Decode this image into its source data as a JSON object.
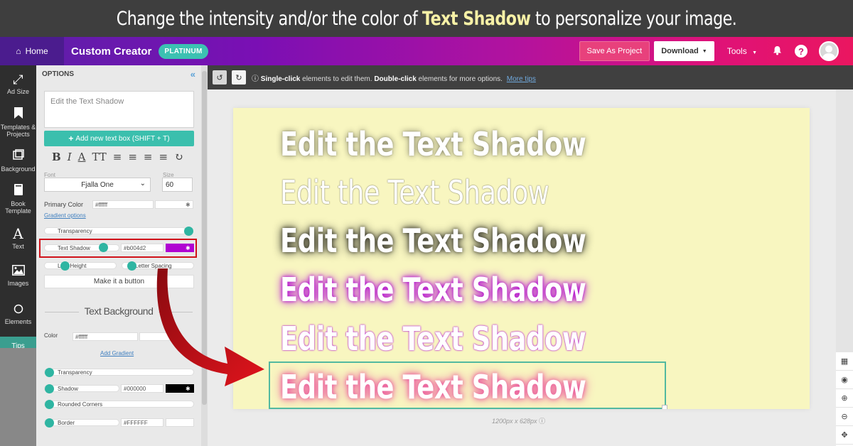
{
  "banner": {
    "prefix": "Change the intensity and/or the color of",
    "highlight": "Text Shadow",
    "suffix": "to personalize your image."
  },
  "nav": {
    "home": "Home",
    "brand": "Custom Creator",
    "badge": "PLATINUM",
    "save": "Save As Project",
    "download": "Download",
    "tools": "Tools",
    "help": "?"
  },
  "sidebar": {
    "items": [
      {
        "label": "Ad Size",
        "icon": "resize-icon"
      },
      {
        "label": "Templates & Projects",
        "icon": "bookmark-icon"
      },
      {
        "label": "Background",
        "icon": "background-icon"
      },
      {
        "label": "Book Template",
        "icon": "book-icon"
      },
      {
        "label": "Text",
        "icon": "text-icon"
      },
      {
        "label": "Images",
        "icon": "image-icon"
      },
      {
        "label": "Elements",
        "icon": "circle-icon"
      }
    ],
    "tips": "Tips"
  },
  "options": {
    "header": "OPTIONS",
    "textbox": "Edit the Text Shadow",
    "add_text": "Add new text box (SHIFT + T)",
    "font_label": "Font",
    "font_value": "Fjalla One",
    "size_label": "Size",
    "size_value": "60",
    "primary_color_label": "Primary Color",
    "primary_color_value": "#ffffff",
    "gradient_options": "Gradient options",
    "transparency": "Transparency",
    "text_shadow": "Text Shadow",
    "text_shadow_value": "#b004d2",
    "line_height": "Line Height",
    "letter_spacing": "Letter Spacing",
    "make_button": "Make it a button",
    "text_background": "Text Background",
    "color_label": "Color",
    "bg_color_value": "#ffffff",
    "add_gradient": "Add Gradient",
    "bg_transparency": "Transparency",
    "shadow": "Shadow",
    "shadow_value": "#000000",
    "rounded_corners": "Rounded Corners",
    "border": "Border",
    "border_value": "#FFFFFF"
  },
  "editor": {
    "hint_single": "Single-click",
    "hint_mid": " elements to edit them. ",
    "hint_double": "Double-click",
    "hint_end": " elements for more options.",
    "more_tips": "More tips",
    "dimensions": "1200px x 628px"
  },
  "canvas": {
    "lines": [
      "Edit the Text Shadow",
      "Edit the Text Shadow",
      "Edit the Text Shadow",
      "Edit the Text Shadow",
      "Edit the Text Shadow",
      "Edit the Text Shadow"
    ],
    "background": "#f8f6c0"
  },
  "colors": {
    "accent": "#3bbfad",
    "shadow_purple": "#b004d2",
    "highlight_red": "#d0121a",
    "arrow_red": "#c2101a"
  }
}
